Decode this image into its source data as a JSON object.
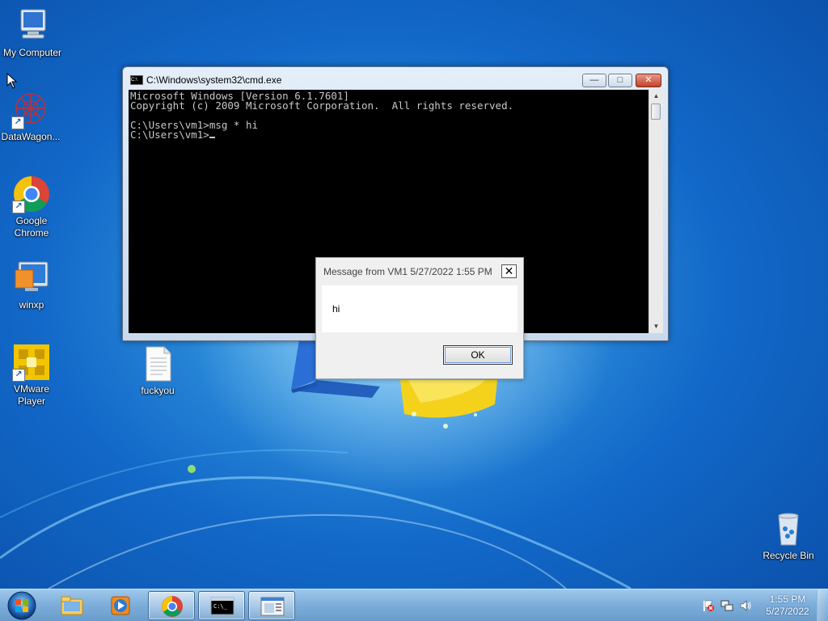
{
  "desktop": {
    "icons": [
      {
        "label": "My Computer",
        "icon": "my-computer-icon"
      },
      {
        "label": "DataWagon...",
        "icon": "datawagon-icon"
      },
      {
        "label": "Google Chrome",
        "icon": "chrome-icon"
      },
      {
        "label": "winxp",
        "icon": "winxp-vm-icon"
      },
      {
        "label": "VMware Player",
        "icon": "vmware-player-icon"
      },
      {
        "label": "fuckyou",
        "icon": "text-file-icon"
      },
      {
        "label": "Recycle Bin",
        "icon": "recycle-bin-icon"
      }
    ]
  },
  "cmd_window": {
    "title": "C:\\Windows\\system32\\cmd.exe",
    "minimize_label": "—",
    "maximize_label": "□",
    "close_label": "✕",
    "console_lines": "Microsoft Windows [Version 6.1.7601]\nCopyright (c) 2009 Microsoft Corporation.  All rights reserved.\n\nC:\\Users\\vm1>msg * hi\n",
    "prompt": "C:\\Users\\vm1>"
  },
  "message_dialog": {
    "title": "Message from VM1 5/27/2022 1:55 PM",
    "close_label": "✕",
    "message": "hi",
    "ok_label": "OK"
  },
  "taskbar": {
    "pinned": [
      {
        "name": "windows-explorer",
        "active": false
      },
      {
        "name": "media-player",
        "active": false
      },
      {
        "name": "google-chrome",
        "active": true
      },
      {
        "name": "command-prompt",
        "active": true
      },
      {
        "name": "message-window",
        "active": true
      }
    ],
    "tray": {
      "time": "1:55 PM",
      "date": "5/27/2022"
    }
  },
  "colors": {
    "desktop_blue": "#1268c8",
    "console_bg": "#000000",
    "console_fg": "#c8c8c8",
    "close_red": "#c5402a"
  }
}
